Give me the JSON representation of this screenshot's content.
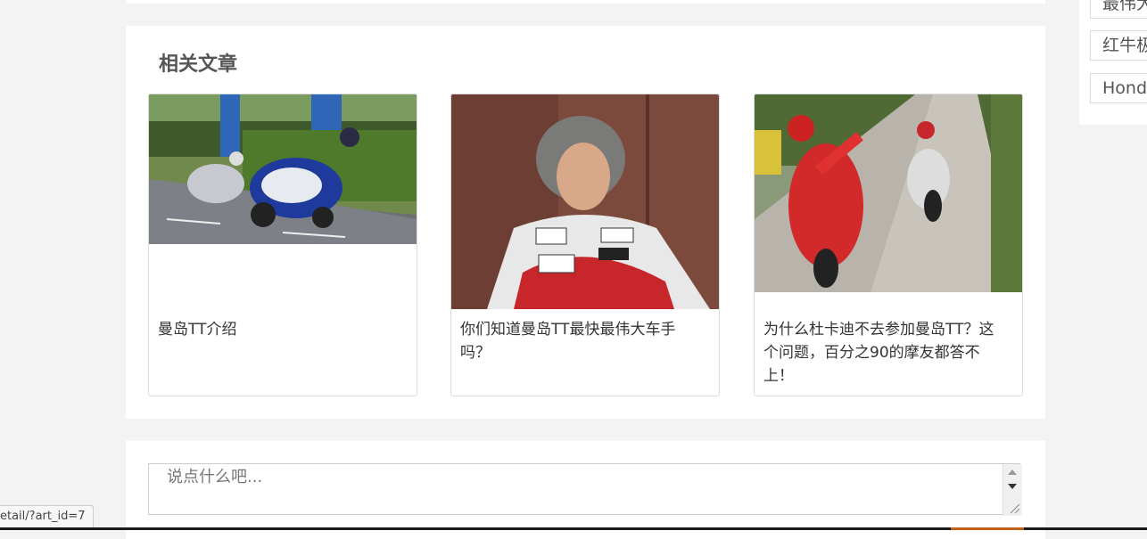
{
  "related": {
    "title": "相关文章",
    "articles": [
      {
        "title": "曼岛TT介绍",
        "image": "motorcycle-racing-photo"
      },
      {
        "title": "你们知道曼岛TT最快最伟大车手吗？",
        "image": "rider-portrait-photo"
      },
      {
        "title": "为什么杜卡迪不去参加曼岛TT？这个问题，百分之90的摩友都答不上！",
        "image": "ducati-riders-photo"
      }
    ]
  },
  "comment": {
    "placeholder": "说点什么吧..."
  },
  "sidebar": {
    "tags": [
      "最伟大",
      "红牛极",
      "Honda"
    ]
  },
  "status_bar": {
    "url": "etail/?art_id=7"
  }
}
